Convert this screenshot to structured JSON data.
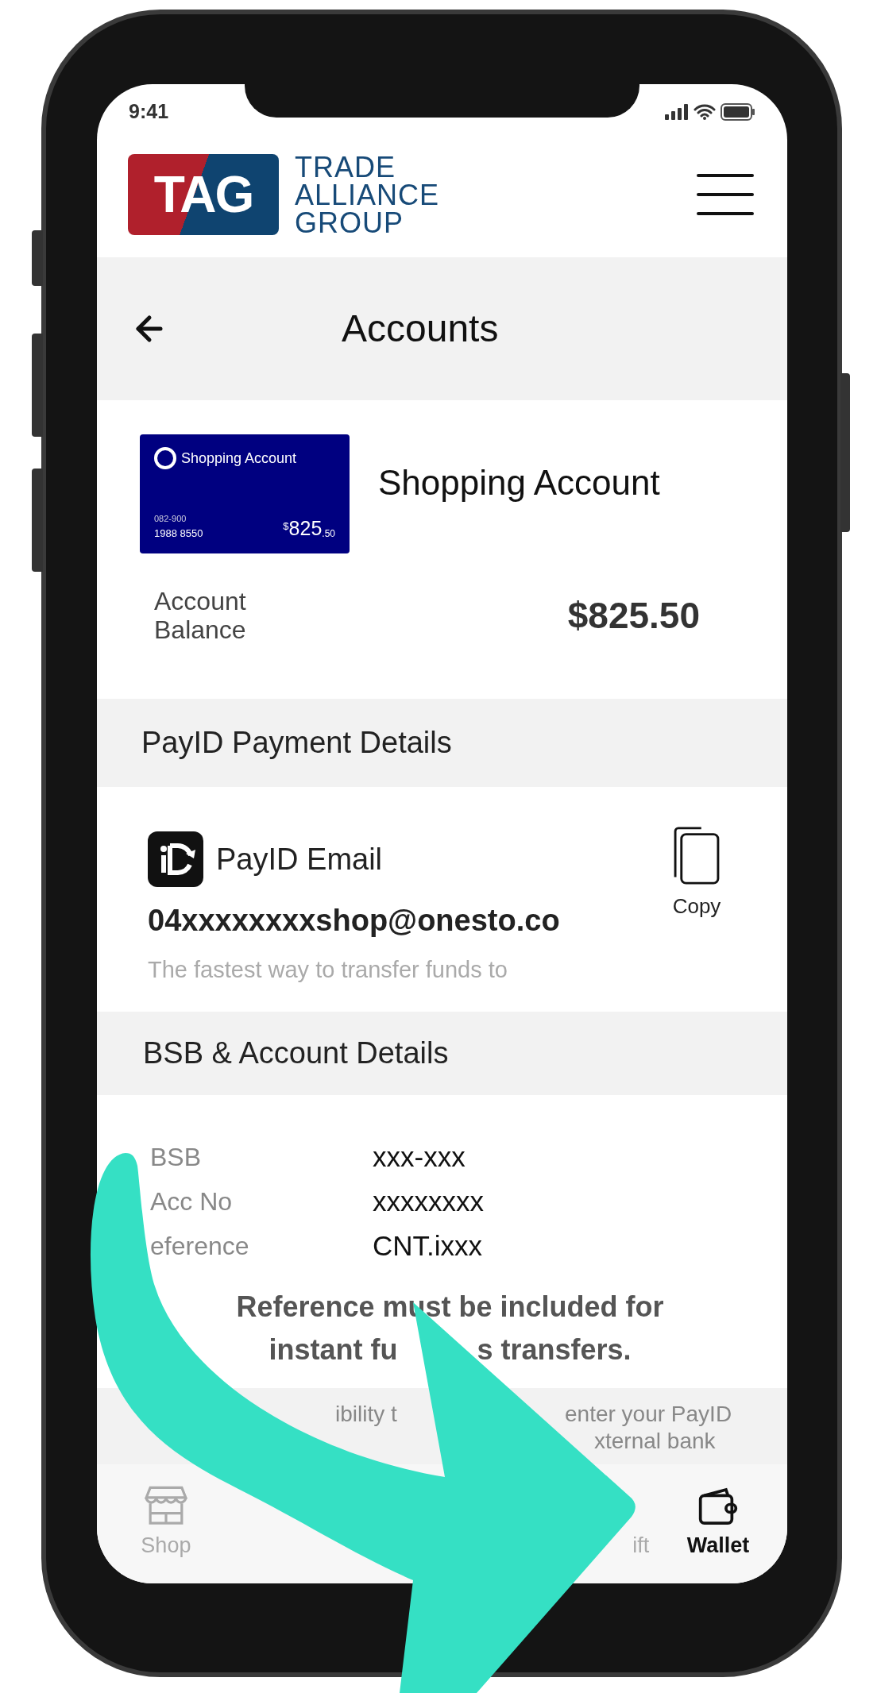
{
  "status_bar": {
    "time": "9:41"
  },
  "logo": {
    "mark": "TAG",
    "lines": [
      "TRADE",
      "ALLIANCE",
      "GROUP"
    ]
  },
  "header": {
    "title": "Accounts"
  },
  "account": {
    "card": {
      "name": "Shopping Account",
      "bsb": "082-900",
      "number": "1988 8550",
      "currency": "$",
      "whole": "825",
      "cents": ".50"
    },
    "title": "Shopping Account",
    "balance_label": "Account Balance",
    "balance": "$825.50"
  },
  "payid": {
    "heading": "PayID Payment Details",
    "label": "PayID Email",
    "email": "04xxxxxxxxshop@onesto.co",
    "description": "The fastest way to transfer funds to",
    "copy": "Copy"
  },
  "bank": {
    "heading": "BSB & Account Details",
    "rows": [
      {
        "label": "BSB",
        "value": "xxx-xxx"
      },
      {
        "label": "Acc No",
        "value": "xxxxxxxx"
      },
      {
        "label": "eference",
        "value": "CNT.ixxx"
      }
    ],
    "note_line_1": "Reference must be included for",
    "note_line_2_parts": [
      "instant fu",
      "s transfers."
    ]
  },
  "info": {
    "line_1_parts": [
      "ibility t",
      "enter your PayID"
    ],
    "line_2": "xternal bank"
  },
  "nav": {
    "items": [
      {
        "kind": "shop",
        "label": "Shop",
        "selected": false
      },
      {
        "kind": "gift",
        "label": "ift",
        "selected": false
      },
      {
        "kind": "wallet",
        "label": "Wallet",
        "selected": true
      }
    ]
  }
}
